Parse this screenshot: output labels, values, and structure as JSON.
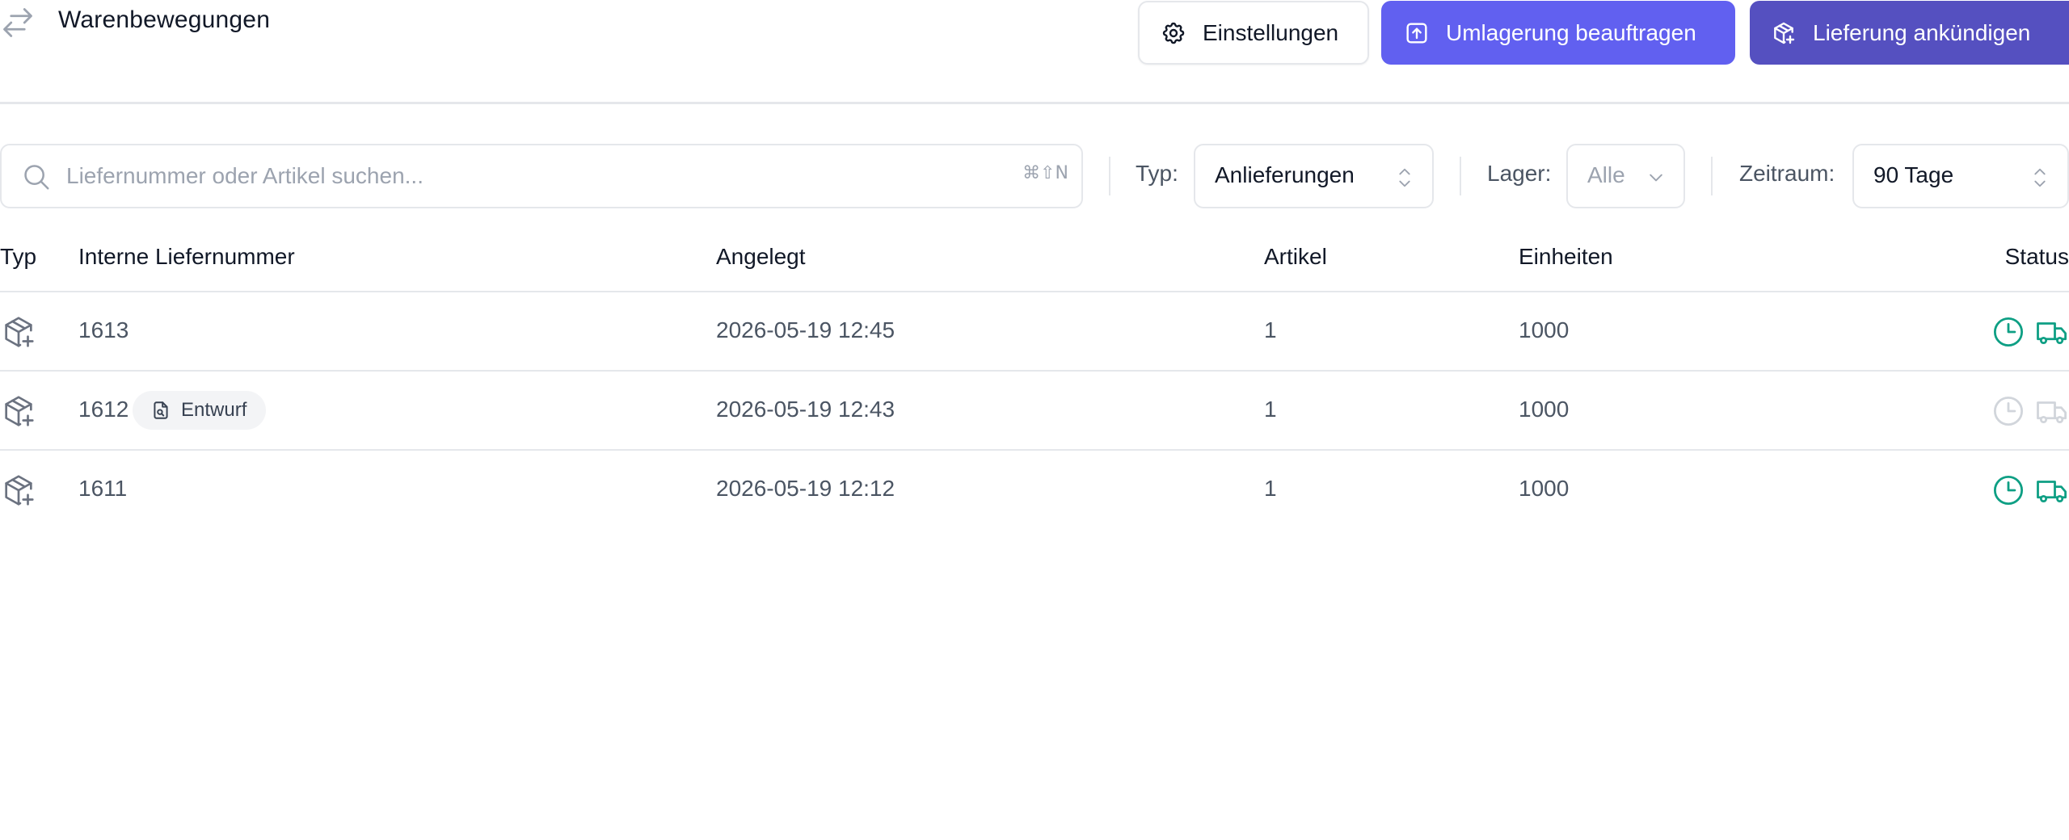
{
  "header": {
    "title": "Warenbewegungen",
    "title_icon": "arrows-right-left-icon",
    "buttons": {
      "settings": "Einstellungen",
      "transfer": "Umlagerung beauftragen",
      "delivery": "Lieferung ankündigen"
    }
  },
  "filters": {
    "search": {
      "placeholder": "Liefernummer oder Artikel suchen...",
      "value": "",
      "shortcut": "⌘⇧N"
    },
    "type": {
      "label": "Typ:",
      "value": "Anlieferungen"
    },
    "warehouse": {
      "label": "Lager:",
      "value": "Alle"
    },
    "period": {
      "label": "Zeitraum:",
      "value": "90 Tage"
    }
  },
  "table": {
    "headers": {
      "type": "Typ",
      "number": "Interne Liefernummer",
      "created": "Angelegt",
      "articles": "Artikel",
      "units": "Einheiten",
      "status": "Status"
    },
    "rows": [
      {
        "type_icon": "package-plus-icon",
        "number": "1613",
        "badge": "",
        "created": "2026-05-19 12:45",
        "articles": "1",
        "units": "1000",
        "active": true
      },
      {
        "type_icon": "package-plus-icon",
        "number": "1612",
        "badge": "Entwurf",
        "created": "2026-05-19 12:43",
        "articles": "1",
        "units": "1000",
        "active": false
      },
      {
        "type_icon": "package-plus-icon",
        "number": "1611",
        "badge": "",
        "created": "2026-05-19 12:12",
        "articles": "1",
        "units": "1000",
        "active": true
      }
    ]
  },
  "colors": {
    "primary": "#6160f0",
    "primary_dark": "#5550c0",
    "status_active": "#0e9f84",
    "status_inactive": "#d1d5db",
    "border": "#e5e7eb",
    "muted_text": "#4b5563"
  }
}
